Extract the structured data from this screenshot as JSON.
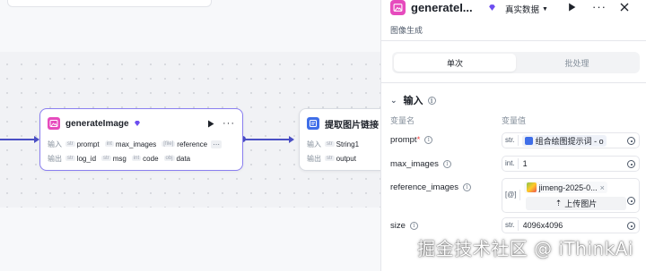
{
  "canvas": {
    "node_main": {
      "title": "generateImage",
      "input_label": "输入",
      "output_label": "输出",
      "inputs": [
        {
          "type": "str",
          "name": "prompt"
        },
        {
          "type": "int",
          "name": "max_images"
        },
        {
          "type": "[file]",
          "name": "reference"
        }
      ],
      "outputs": [
        {
          "type": "str",
          "name": "log_id"
        },
        {
          "type": "str",
          "name": "msg"
        },
        {
          "type": "int",
          "name": "code"
        },
        {
          "type": "obj",
          "name": "data"
        }
      ]
    },
    "node_second": {
      "title": "提取图片链接",
      "input_label": "输入",
      "output_label": "输出",
      "inputs": [
        {
          "type": "str",
          "name": "String1"
        }
      ],
      "outputs": [
        {
          "type": "str",
          "name": "output"
        }
      ]
    }
  },
  "panel": {
    "title": "generateI...",
    "data_mode": "真实数据",
    "subtitle": "图像生成",
    "tabs": [
      {
        "label": "单次",
        "active": true
      },
      {
        "label": "批处理",
        "active": false
      }
    ],
    "section_title": "输入",
    "col_name": "变量名",
    "col_value": "变量值",
    "params": [
      {
        "name": "prompt",
        "required": "*",
        "type": "str.",
        "value": "组合绘图提示词 - o"
      },
      {
        "name": "max_images",
        "required": "",
        "type": "int.",
        "value": "1"
      },
      {
        "name": "reference_images",
        "required": "",
        "type": "[@]",
        "value": "jimeng-2025-0...",
        "upload": "上传图片"
      },
      {
        "name": "size",
        "required": "",
        "type": "str.",
        "value": "4096x4096"
      }
    ]
  },
  "watermark": "掘金技术社区 @ iThinkAi"
}
